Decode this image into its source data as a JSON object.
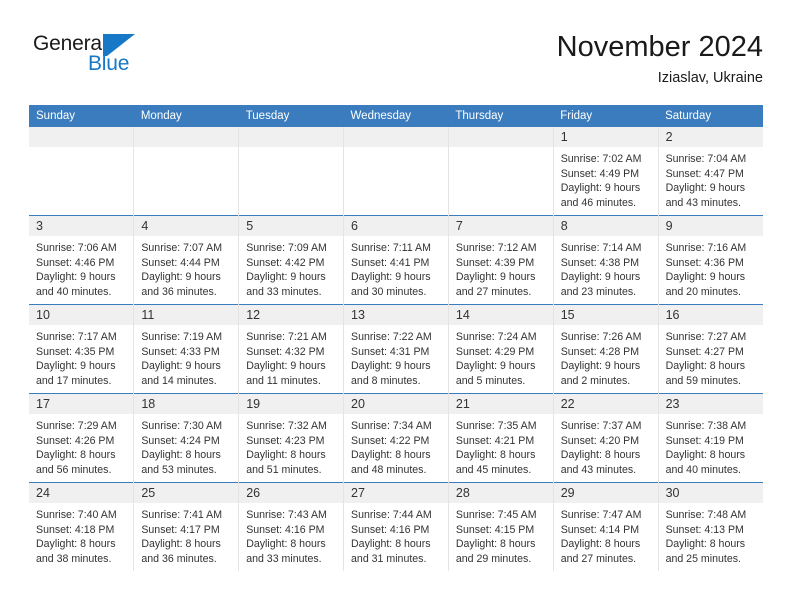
{
  "brand": {
    "name_part1": "General",
    "name_part2": "Blue",
    "logo_icon": "triangle-flag-icon",
    "accent_color": "#1878c8"
  },
  "header": {
    "title": "November 2024",
    "subtitle": "Iziaslav, Ukraine"
  },
  "colors": {
    "header_blue": "#3a7cbe",
    "daynum_gray": "#f0f0f0",
    "text": "#333333"
  },
  "calendar": {
    "weekday_headers": [
      "Sunday",
      "Monday",
      "Tuesday",
      "Wednesday",
      "Thursday",
      "Friday",
      "Saturday"
    ],
    "weeks": [
      [
        {
          "day": "",
          "sunrise": "",
          "sunset": "",
          "daylight1": "",
          "daylight2": ""
        },
        {
          "day": "",
          "sunrise": "",
          "sunset": "",
          "daylight1": "",
          "daylight2": ""
        },
        {
          "day": "",
          "sunrise": "",
          "sunset": "",
          "daylight1": "",
          "daylight2": ""
        },
        {
          "day": "",
          "sunrise": "",
          "sunset": "",
          "daylight1": "",
          "daylight2": ""
        },
        {
          "day": "",
          "sunrise": "",
          "sunset": "",
          "daylight1": "",
          "daylight2": ""
        },
        {
          "day": "1",
          "sunrise": "Sunrise: 7:02 AM",
          "sunset": "Sunset: 4:49 PM",
          "daylight1": "Daylight: 9 hours",
          "daylight2": "and 46 minutes."
        },
        {
          "day": "2",
          "sunrise": "Sunrise: 7:04 AM",
          "sunset": "Sunset: 4:47 PM",
          "daylight1": "Daylight: 9 hours",
          "daylight2": "and 43 minutes."
        }
      ],
      [
        {
          "day": "3",
          "sunrise": "Sunrise: 7:06 AM",
          "sunset": "Sunset: 4:46 PM",
          "daylight1": "Daylight: 9 hours",
          "daylight2": "and 40 minutes."
        },
        {
          "day": "4",
          "sunrise": "Sunrise: 7:07 AM",
          "sunset": "Sunset: 4:44 PM",
          "daylight1": "Daylight: 9 hours",
          "daylight2": "and 36 minutes."
        },
        {
          "day": "5",
          "sunrise": "Sunrise: 7:09 AM",
          "sunset": "Sunset: 4:42 PM",
          "daylight1": "Daylight: 9 hours",
          "daylight2": "and 33 minutes."
        },
        {
          "day": "6",
          "sunrise": "Sunrise: 7:11 AM",
          "sunset": "Sunset: 4:41 PM",
          "daylight1": "Daylight: 9 hours",
          "daylight2": "and 30 minutes."
        },
        {
          "day": "7",
          "sunrise": "Sunrise: 7:12 AM",
          "sunset": "Sunset: 4:39 PM",
          "daylight1": "Daylight: 9 hours",
          "daylight2": "and 27 minutes."
        },
        {
          "day": "8",
          "sunrise": "Sunrise: 7:14 AM",
          "sunset": "Sunset: 4:38 PM",
          "daylight1": "Daylight: 9 hours",
          "daylight2": "and 23 minutes."
        },
        {
          "day": "9",
          "sunrise": "Sunrise: 7:16 AM",
          "sunset": "Sunset: 4:36 PM",
          "daylight1": "Daylight: 9 hours",
          "daylight2": "and 20 minutes."
        }
      ],
      [
        {
          "day": "10",
          "sunrise": "Sunrise: 7:17 AM",
          "sunset": "Sunset: 4:35 PM",
          "daylight1": "Daylight: 9 hours",
          "daylight2": "and 17 minutes."
        },
        {
          "day": "11",
          "sunrise": "Sunrise: 7:19 AM",
          "sunset": "Sunset: 4:33 PM",
          "daylight1": "Daylight: 9 hours",
          "daylight2": "and 14 minutes."
        },
        {
          "day": "12",
          "sunrise": "Sunrise: 7:21 AM",
          "sunset": "Sunset: 4:32 PM",
          "daylight1": "Daylight: 9 hours",
          "daylight2": "and 11 minutes."
        },
        {
          "day": "13",
          "sunrise": "Sunrise: 7:22 AM",
          "sunset": "Sunset: 4:31 PM",
          "daylight1": "Daylight: 9 hours",
          "daylight2": "and 8 minutes."
        },
        {
          "day": "14",
          "sunrise": "Sunrise: 7:24 AM",
          "sunset": "Sunset: 4:29 PM",
          "daylight1": "Daylight: 9 hours",
          "daylight2": "and 5 minutes."
        },
        {
          "day": "15",
          "sunrise": "Sunrise: 7:26 AM",
          "sunset": "Sunset: 4:28 PM",
          "daylight1": "Daylight: 9 hours",
          "daylight2": "and 2 minutes."
        },
        {
          "day": "16",
          "sunrise": "Sunrise: 7:27 AM",
          "sunset": "Sunset: 4:27 PM",
          "daylight1": "Daylight: 8 hours",
          "daylight2": "and 59 minutes."
        }
      ],
      [
        {
          "day": "17",
          "sunrise": "Sunrise: 7:29 AM",
          "sunset": "Sunset: 4:26 PM",
          "daylight1": "Daylight: 8 hours",
          "daylight2": "and 56 minutes."
        },
        {
          "day": "18",
          "sunrise": "Sunrise: 7:30 AM",
          "sunset": "Sunset: 4:24 PM",
          "daylight1": "Daylight: 8 hours",
          "daylight2": "and 53 minutes."
        },
        {
          "day": "19",
          "sunrise": "Sunrise: 7:32 AM",
          "sunset": "Sunset: 4:23 PM",
          "daylight1": "Daylight: 8 hours",
          "daylight2": "and 51 minutes."
        },
        {
          "day": "20",
          "sunrise": "Sunrise: 7:34 AM",
          "sunset": "Sunset: 4:22 PM",
          "daylight1": "Daylight: 8 hours",
          "daylight2": "and 48 minutes."
        },
        {
          "day": "21",
          "sunrise": "Sunrise: 7:35 AM",
          "sunset": "Sunset: 4:21 PM",
          "daylight1": "Daylight: 8 hours",
          "daylight2": "and 45 minutes."
        },
        {
          "day": "22",
          "sunrise": "Sunrise: 7:37 AM",
          "sunset": "Sunset: 4:20 PM",
          "daylight1": "Daylight: 8 hours",
          "daylight2": "and 43 minutes."
        },
        {
          "day": "23",
          "sunrise": "Sunrise: 7:38 AM",
          "sunset": "Sunset: 4:19 PM",
          "daylight1": "Daylight: 8 hours",
          "daylight2": "and 40 minutes."
        }
      ],
      [
        {
          "day": "24",
          "sunrise": "Sunrise: 7:40 AM",
          "sunset": "Sunset: 4:18 PM",
          "daylight1": "Daylight: 8 hours",
          "daylight2": "and 38 minutes."
        },
        {
          "day": "25",
          "sunrise": "Sunrise: 7:41 AM",
          "sunset": "Sunset: 4:17 PM",
          "daylight1": "Daylight: 8 hours",
          "daylight2": "and 36 minutes."
        },
        {
          "day": "26",
          "sunrise": "Sunrise: 7:43 AM",
          "sunset": "Sunset: 4:16 PM",
          "daylight1": "Daylight: 8 hours",
          "daylight2": "and 33 minutes."
        },
        {
          "day": "27",
          "sunrise": "Sunrise: 7:44 AM",
          "sunset": "Sunset: 4:16 PM",
          "daylight1": "Daylight: 8 hours",
          "daylight2": "and 31 minutes."
        },
        {
          "day": "28",
          "sunrise": "Sunrise: 7:45 AM",
          "sunset": "Sunset: 4:15 PM",
          "daylight1": "Daylight: 8 hours",
          "daylight2": "and 29 minutes."
        },
        {
          "day": "29",
          "sunrise": "Sunrise: 7:47 AM",
          "sunset": "Sunset: 4:14 PM",
          "daylight1": "Daylight: 8 hours",
          "daylight2": "and 27 minutes."
        },
        {
          "day": "30",
          "sunrise": "Sunrise: 7:48 AM",
          "sunset": "Sunset: 4:13 PM",
          "daylight1": "Daylight: 8 hours",
          "daylight2": "and 25 minutes."
        }
      ]
    ]
  }
}
